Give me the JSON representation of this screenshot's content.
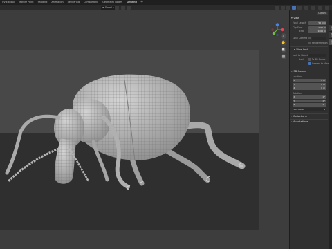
{
  "topbar": {
    "tabs": [
      "UV Editing",
      "Texture Paint",
      "Shading",
      "Animation",
      "Rendering",
      "Compositing",
      "Geometry Nodes",
      "Scripting"
    ],
    "active_tab": 7,
    "add_label": "+"
  },
  "header": {
    "transform_orientation": "Global",
    "proportional": "•",
    "snap": "⌇"
  },
  "gizmo": {
    "x_color": "#e04a5f",
    "y_color": "#76b84a",
    "z_color": "#4a83e0"
  },
  "nav_buttons": [
    "search-icon",
    "hand-icon",
    "camera-icon",
    "grid-icon"
  ],
  "npanel": {
    "options_label": "Options",
    "tabs": [
      "Item",
      "Tool",
      "View"
    ],
    "view": {
      "title": "View",
      "focal_length_label": "Focal Length",
      "focal_length_value": "50 mm",
      "clip_start_label": "Clip Start",
      "clip_start_value": "0.01 m",
      "clip_end_label": "End",
      "clip_end_value": "1000 m",
      "local_camera_label": "Local Camera",
      "render_region_label": "Render Region",
      "view_lock_title": "View Lock",
      "lock_to_object_label": "Lock to Object",
      "lock_label": "Lock",
      "to_3d_cursor_label": "To 3D Cursor",
      "camera_to_view_label": "Camera to View"
    },
    "cursor": {
      "title": "3D Cursor",
      "location_label": "Location",
      "x_label": "X",
      "x_value": "0 m",
      "y_label": "Y",
      "y_value": "0 m",
      "z_label": "Z",
      "z_value": "0 m",
      "rotation_label": "Rotation",
      "rx_label": "X",
      "rx_value": "0°",
      "ry_label": "Y",
      "ry_value": "0°",
      "rz_label": "Z",
      "rz_value": "0°",
      "mode_value": "XYZ Euler"
    },
    "collapsed": [
      "Collections",
      "Annotations"
    ]
  }
}
